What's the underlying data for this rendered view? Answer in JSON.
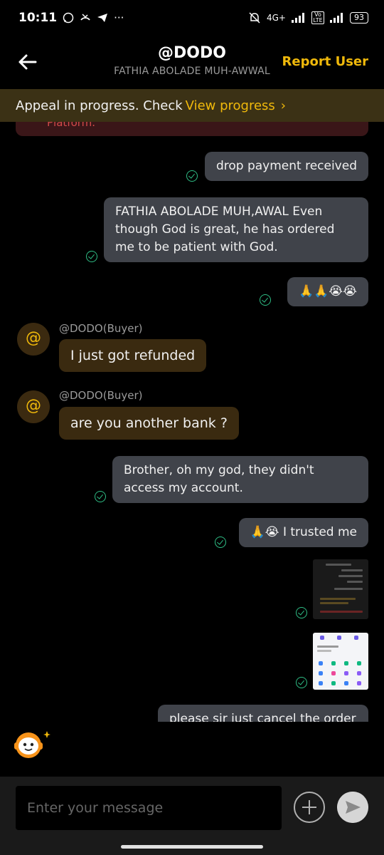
{
  "status_bar": {
    "time": "10:11",
    "network": "4G+",
    "volte": "Vo LTE",
    "battery": "93"
  },
  "header": {
    "title": "@DODO",
    "subtitle": "FATHIA ABOLADE MUH-AWWAL",
    "report_label": "Report User"
  },
  "appeal_banner": {
    "text": "Appeal in progress. Check",
    "link": "View progress",
    "chevron": "›"
  },
  "chat": {
    "cutoff_text": "Platform.",
    "messages": [
      {
        "type": "outgoing",
        "text": "drop payment received"
      },
      {
        "type": "outgoing",
        "text": "FATHIA ABOLADE MUH,AWAL Even though God is great, he has ordered me to be patient with God."
      },
      {
        "type": "outgoing",
        "text": "🙏🙏😭😭"
      },
      {
        "type": "incoming",
        "sender": "@DODO(Buyer)",
        "avatar": "@",
        "text": "I just got refunded"
      },
      {
        "type": "incoming",
        "sender": "@DODO(Buyer)",
        "avatar": "@",
        "text": "are you another bank ?"
      },
      {
        "type": "outgoing",
        "text": "Brother, oh my god, they didn't access my account."
      },
      {
        "type": "outgoing",
        "text": "🙏😭 I trusted me"
      },
      {
        "type": "outgoing",
        "text": "please sir just cancel the order"
      }
    ]
  },
  "input": {
    "placeholder": "Enter your message"
  },
  "icons": {
    "back": "back-arrow-icon",
    "plus": "plus-icon",
    "send": "send-icon",
    "support_bot": "support-bot-icon"
  },
  "colors": {
    "accent": "#f0b90b",
    "check": "#2ebd85",
    "outgoing_bubble": "#40434a",
    "incoming_bubble": "#3a2a10",
    "banner": "#3b3115"
  }
}
